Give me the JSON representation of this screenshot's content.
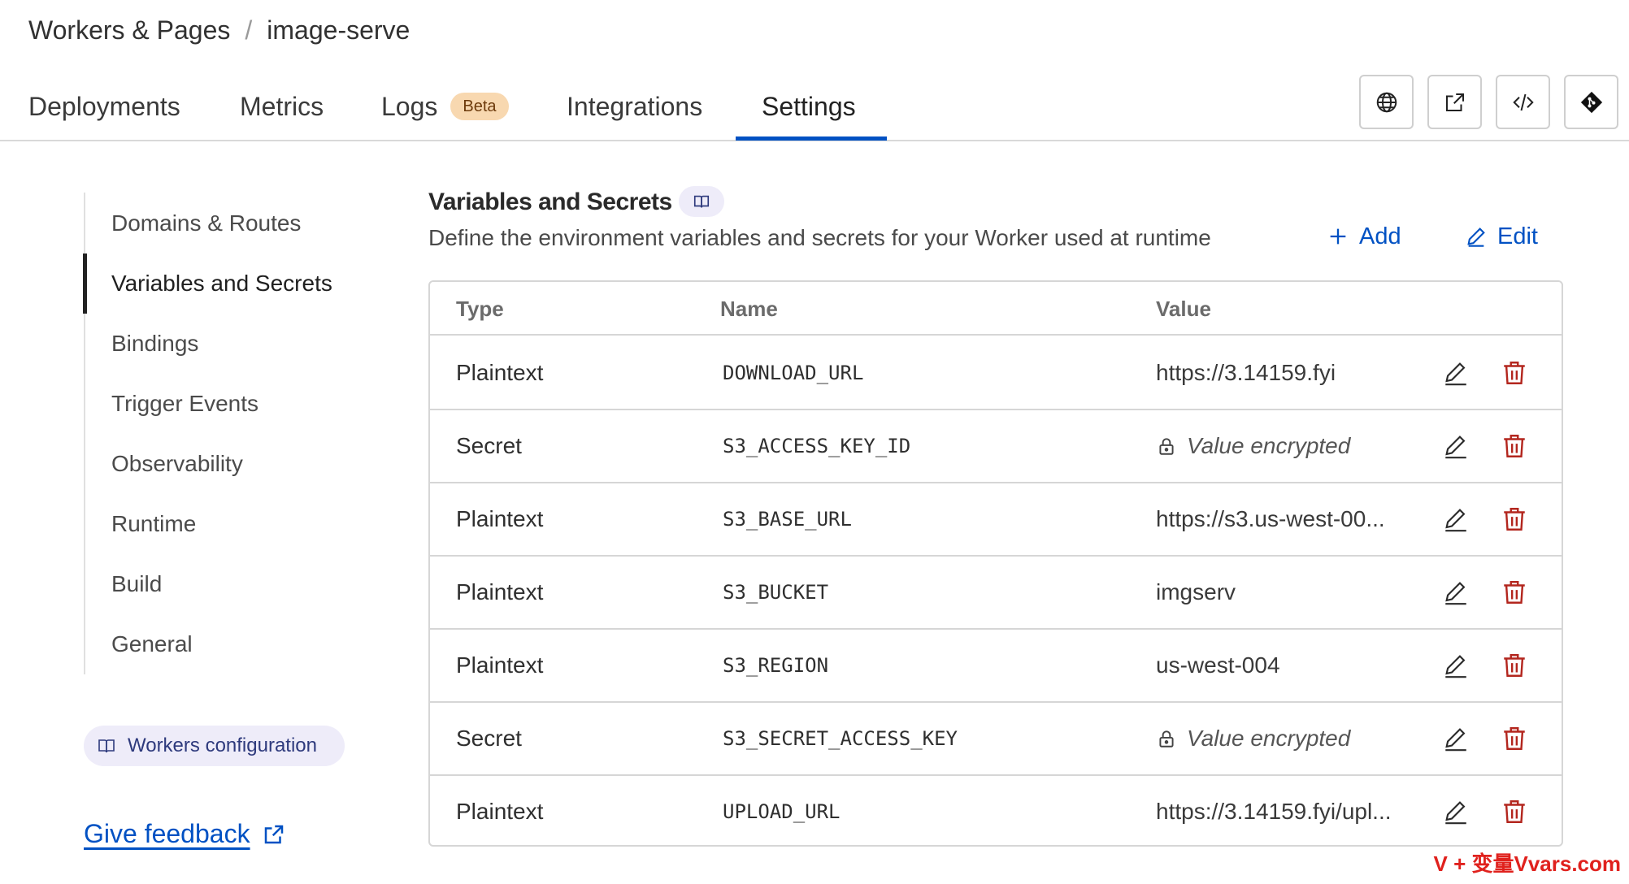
{
  "breadcrumb": {
    "parent": "Workers & Pages",
    "separator": "/",
    "current": "image-serve"
  },
  "tabs": [
    {
      "label": "Deployments"
    },
    {
      "label": "Metrics"
    },
    {
      "label": "Logs",
      "badge": "Beta"
    },
    {
      "label": "Integrations"
    },
    {
      "label": "Settings",
      "active": true
    }
  ],
  "toolbar_icons": [
    "globe-icon",
    "external-link-icon",
    "code-icon",
    "git-icon"
  ],
  "sidebar": {
    "items": [
      {
        "label": "Domains & Routes"
      },
      {
        "label": "Variables and Secrets",
        "active": true
      },
      {
        "label": "Bindings"
      },
      {
        "label": "Trigger Events"
      },
      {
        "label": "Observability"
      },
      {
        "label": "Runtime"
      },
      {
        "label": "Build"
      },
      {
        "label": "General"
      }
    ],
    "config_link": "Workers configuration",
    "feedback_link": "Give feedback"
  },
  "section": {
    "title": "Variables and Secrets",
    "description": "Define the environment variables and secrets for your Worker used at runtime",
    "add_label": "Add",
    "edit_label": "Edit"
  },
  "table": {
    "columns": [
      "Type",
      "Name",
      "Value"
    ],
    "rows": [
      {
        "type": "Plaintext",
        "name": "DOWNLOAD_URL",
        "value": "https://3.14159.fyi",
        "encrypted": false
      },
      {
        "type": "Secret",
        "name": "S3_ACCESS_KEY_ID",
        "value": "Value encrypted",
        "encrypted": true
      },
      {
        "type": "Plaintext",
        "name": "S3_BASE_URL",
        "value": "https://s3.us-west-00...",
        "encrypted": false
      },
      {
        "type": "Plaintext",
        "name": "S3_BUCKET",
        "value": "imgserv",
        "encrypted": false
      },
      {
        "type": "Plaintext",
        "name": "S3_REGION",
        "value": "us-west-004",
        "encrypted": false
      },
      {
        "type": "Secret",
        "name": "S3_SECRET_ACCESS_KEY",
        "value": "Value encrypted",
        "encrypted": true
      },
      {
        "type": "Plaintext",
        "name": "UPLOAD_URL",
        "value": "https://3.14159.fyi/upl...",
        "encrypted": false
      }
    ]
  },
  "colors": {
    "accent": "#0051c3",
    "danger": "#b3261e",
    "beta_bg": "#f8d8b0",
    "pill_bg": "#eeecf9"
  },
  "watermark": "V + 变量Vvars.com"
}
